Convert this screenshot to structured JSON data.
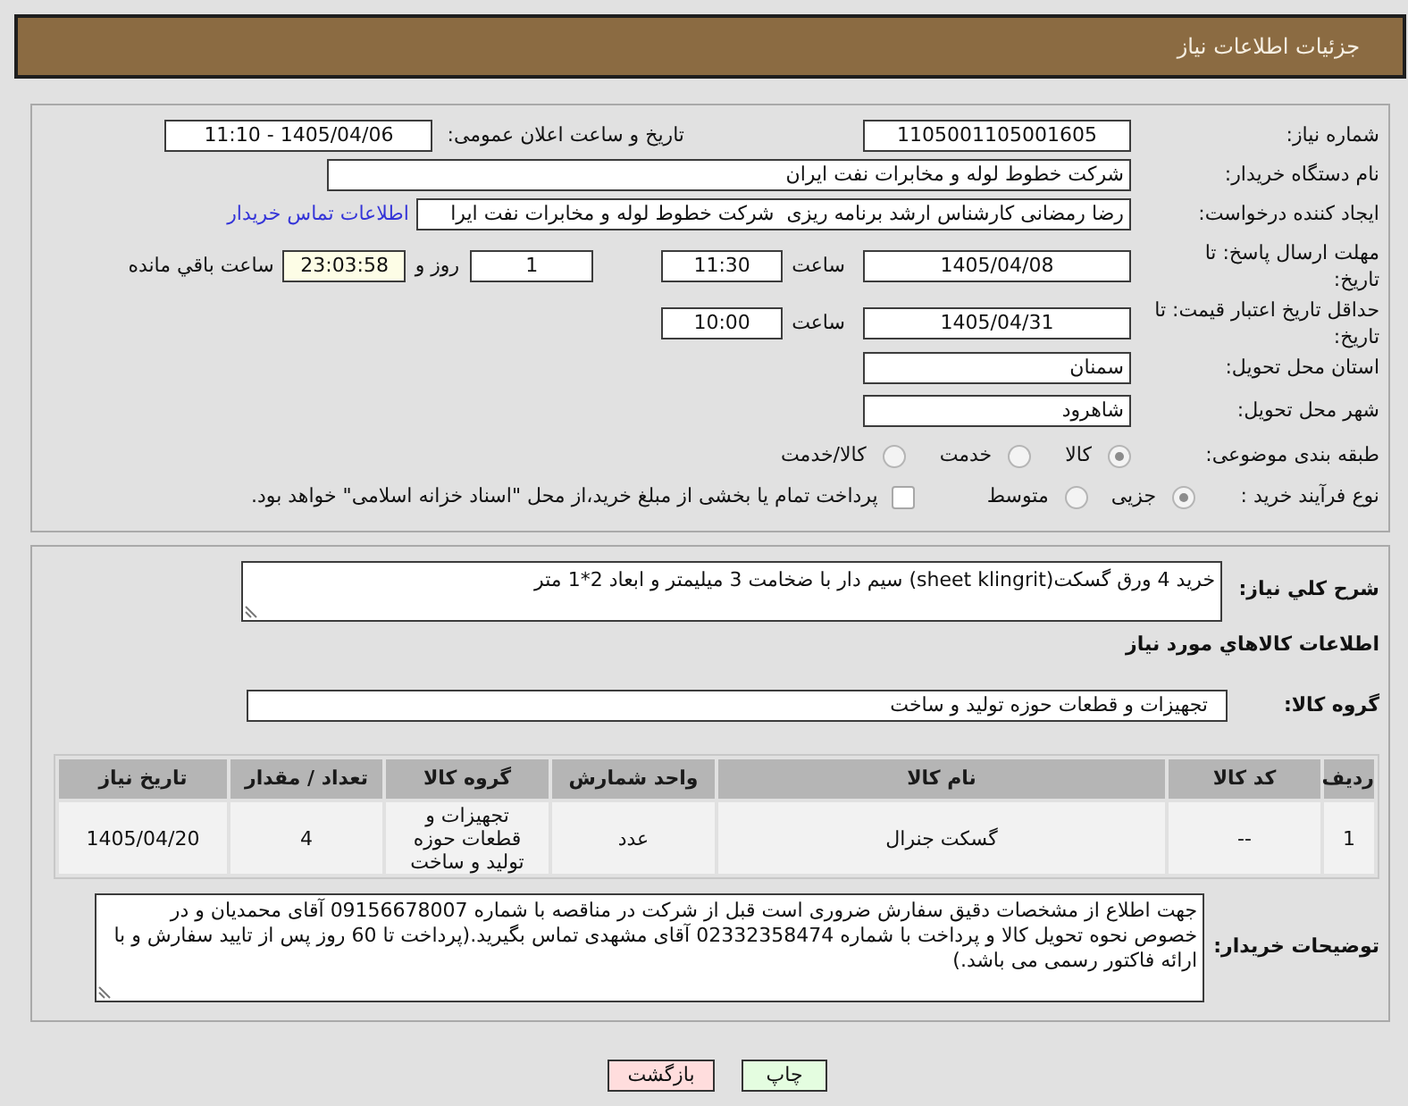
{
  "header": {
    "title": "جزئیات اطلاعات نیاز"
  },
  "details": {
    "need_number": {
      "label": "شماره نیاز:",
      "value": "1105001105001605"
    },
    "announcement": {
      "label": "تاریخ و ساعت اعلان عمومی:",
      "value": "1405/04/06 - 11:10"
    },
    "buyer_org": {
      "label": "نام دستگاه خریدار:",
      "value": "شرکت خطوط لوله و مخابرات نفت ایران"
    },
    "requester": {
      "label": "ایجاد کننده درخواست:",
      "value": "رضا رمضانی کارشناس ارشد برنامه ریزی  شرکت خطوط لوله و مخابرات نفت ایرا",
      "link": "اطلاعات تماس خریدار"
    },
    "reply_deadline": {
      "label": "مهلت ارسال پاسخ: تا تاریخ:",
      "date": "1405/04/08",
      "time_label": "ساعت",
      "time": "11:30",
      "days": "1",
      "days_label": "روز و",
      "remaining": "23:03:58",
      "remaining_label": "ساعت باقي مانده"
    },
    "price_validity": {
      "label": "حداقل تاریخ اعتبار قیمت: تا تاریخ:",
      "date": "1405/04/31",
      "time_label": "ساعت",
      "time": "10:00"
    },
    "province": {
      "label": "استان محل تحویل:",
      "value": "سمنان"
    },
    "city": {
      "label": "شهر محل تحویل:",
      "value": "شاهرود"
    },
    "category": {
      "label": "طبقه بندی موضوعی:",
      "options": [
        {
          "label": "کالا",
          "selected": true
        },
        {
          "label": "خدمت",
          "selected": false
        },
        {
          "label": "کالا/خدمت",
          "selected": false
        }
      ]
    },
    "purchase_type": {
      "label": "نوع فرآیند خرید :",
      "options": [
        {
          "label": "جزیی",
          "selected": true
        },
        {
          "label": "متوسط",
          "selected": false
        }
      ],
      "treasury": {
        "label": "پرداخت تمام یا بخشی از مبلغ خرید،از محل \"اسناد خزانه اسلامی\" خواهد بود.",
        "checked": false
      }
    }
  },
  "need": {
    "summary": {
      "label": "شرح کلي نیاز:",
      "value": "خرید 4 ورق گسکت(sheet klingrit) سیم دار با ضخامت 3 میلیمتر و ابعاد 2*1 متر"
    },
    "goods_title": "اطلاعات کالاهاي مورد نیاز",
    "goods_group": {
      "label": "گروه کالا:",
      "value": "تجهیزات و قطعات حوزه تولید و ساخت"
    },
    "table": {
      "columns": [
        "ردیف",
        "کد کالا",
        "نام کالا",
        "واحد شمارش",
        "گروه کالا",
        "تعداد / مقدار",
        "تاریخ نیاز"
      ],
      "rows": [
        [
          "1",
          "--",
          "گسکت جنرال",
          "عدد",
          "تجهیزات و قطعات حوزه تولید و ساخت",
          "4",
          "1405/04/20"
        ]
      ]
    },
    "buyer_notes": {
      "label": "توضیحات خریدار:",
      "value": "جهت اطلاع از مشخصات دقیق سفارش ضروری است قبل از شرکت در مناقصه با شماره 09156678007 آقای محمدیان و در خصوص نحوه تحویل کالا و پرداخت با شماره 02332358474 آقای مشهدی تماس بگیرید.(پرداخت تا 60 روز پس از تایید سفارش و با ارائه فاکتور رسمی می باشد.)"
    }
  },
  "buttons": [
    {
      "label": "چاپ",
      "kind": "print"
    },
    {
      "label": "بازگشت",
      "kind": "back"
    }
  ]
}
